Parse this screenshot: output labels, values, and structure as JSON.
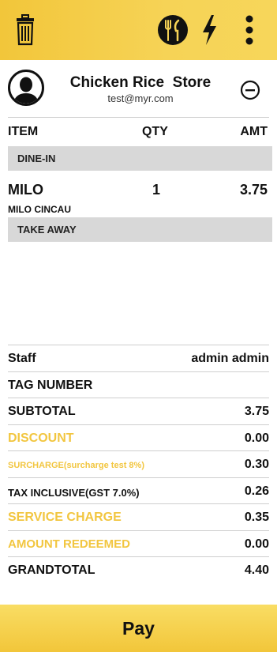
{
  "colors": {
    "accent": "#f6d356",
    "highlight": "#f2c640",
    "band": "#d8d8d8"
  },
  "topbar": {
    "left_icon": "trash-icon",
    "right_icons": [
      "food-utensils-icon",
      "lightning-icon",
      "more-vertical-icon"
    ]
  },
  "store": {
    "name": "Chicken Rice  Store",
    "email": "test@myr.com",
    "avatar_icon": "user-avatar-icon",
    "action_icon": "minus-circle-icon"
  },
  "table": {
    "headers": {
      "item": "ITEM",
      "qty": "QTY",
      "amt": "AMT"
    },
    "sections": [
      {
        "label": "DINE-IN"
      },
      {
        "label": "TAKE AWAY"
      }
    ],
    "items": [
      {
        "name": "MILO",
        "qty": "1",
        "amount": "3.75",
        "modifier": "MILO CINCAU"
      }
    ]
  },
  "summary": {
    "staff": {
      "label": "Staff",
      "value": "admin admin"
    },
    "tag": {
      "label": "TAG NUMBER",
      "value": ""
    },
    "subtotal": {
      "label": "SUBTOTAL",
      "value": "3.75"
    },
    "discount": {
      "label": "DISCOUNT",
      "value": "0.00"
    },
    "surcharge": {
      "label": "SURCHARGE(surcharge test 8%)",
      "value": "0.30"
    },
    "tax": {
      "label": "TAX INCLUSIVE(GST 7.0%)",
      "value": "0.26"
    },
    "service": {
      "label": "SERVICE CHARGE",
      "value": "0.35"
    },
    "redeemed": {
      "label": "AMOUNT REDEEMED",
      "value": "0.00"
    },
    "grandtotal": {
      "label": "GRANDTOTAL",
      "value": "4.40"
    }
  },
  "pay_button": {
    "label": "Pay"
  }
}
